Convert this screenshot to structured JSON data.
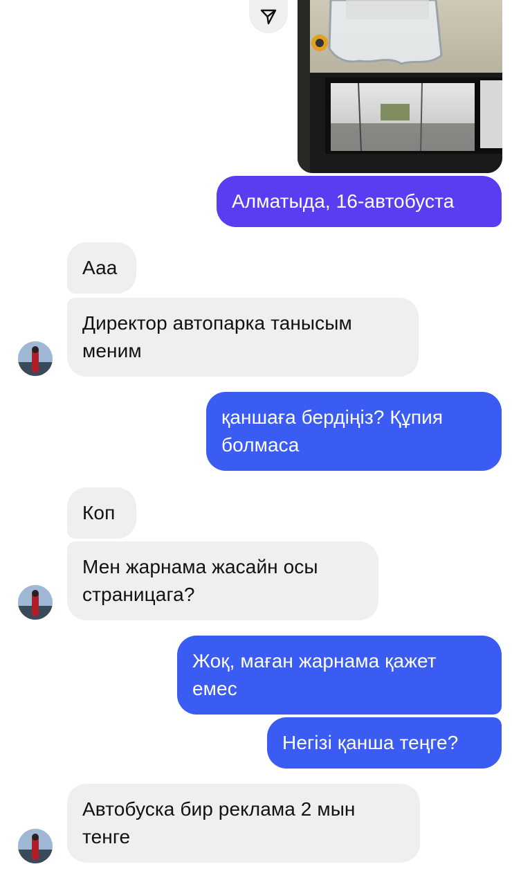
{
  "colors": {
    "incoming_bubble": "#efeff0",
    "incoming_text": "#111111",
    "outgoing_purple": "#5a3df0",
    "outgoing_blue": "#3a5cf2",
    "outgoing_text": "#ffffff"
  },
  "share_button": {
    "icon": "send-paper-plane-icon"
  },
  "photo_message": {
    "description_icon": "bus-interior-photo"
  },
  "messages": [
    {
      "id": "m1",
      "direction": "outgoing",
      "text": "Алматыда, 16-автобуста"
    },
    {
      "id": "m2",
      "direction": "incoming",
      "text": "Ааа"
    },
    {
      "id": "m3",
      "direction": "incoming",
      "text": "Директор автопарка танысым\nменим"
    },
    {
      "id": "m4",
      "direction": "outgoing",
      "text": "қаншаға бердіңіз? Құпия\nболмаса"
    },
    {
      "id": "m5",
      "direction": "incoming",
      "text": "Коп"
    },
    {
      "id": "m6",
      "direction": "incoming",
      "text": "Мен жарнама жасайн осы\nстраницага?"
    },
    {
      "id": "m7",
      "direction": "outgoing",
      "text": "Жоқ, маған жарнама қажет\nемес"
    },
    {
      "id": "m8",
      "direction": "outgoing",
      "text": "Негізі қанша теңге?"
    },
    {
      "id": "m9",
      "direction": "incoming",
      "text": "Автобуска бир реклама 2 мын\nтенге"
    }
  ]
}
